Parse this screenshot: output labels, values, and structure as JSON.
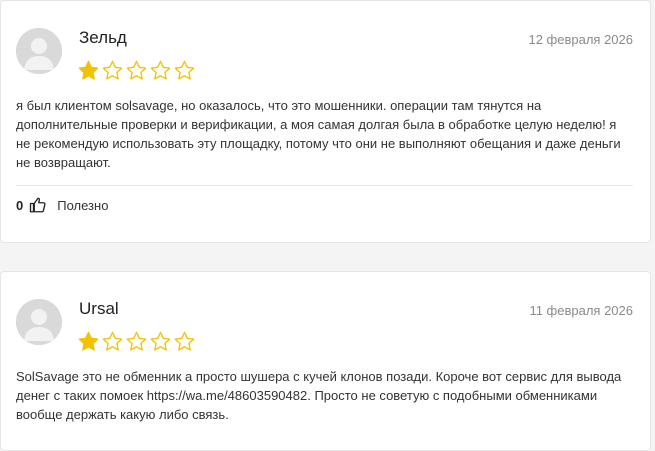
{
  "reviews": [
    {
      "author": "Зельд",
      "date": "12 февраля 2026",
      "rating": 1,
      "max_rating": 5,
      "text": "я был клиентом solsavage, но оказалось, что это мошенники. операции там тянутся на дополнительные проверки и верификации, а моя самая долгая была в обработке целую неделю! я не рекомендую использовать эту площадку, потому что они не выполняют обещания и даже деньги не возвращают.",
      "helpful_count": "0",
      "helpful_label": "Полезно"
    },
    {
      "author": "Ursal",
      "date": "11 февраля 2026",
      "rating": 1,
      "max_rating": 5,
      "text_before_link": "SolSavage это не обменник а просто шушера с кучей клонов позади. Короче вот сервис для вывода денег с таких помоек ",
      "link_text": "https://wa.me/48603590482",
      "text_after_link": ". Просто не советую с подобными обменниками вообще держать какую либо связь."
    }
  ],
  "colors": {
    "star_fill": "#f2c200",
    "star_outline": "#f2c200",
    "date": "#8a8a8a",
    "avatar_bg": "#d9d9d9"
  },
  "icons": {
    "avatar": "user-silhouette-icon",
    "thumb": "thumbs-up-icon",
    "star": "star-icon"
  }
}
